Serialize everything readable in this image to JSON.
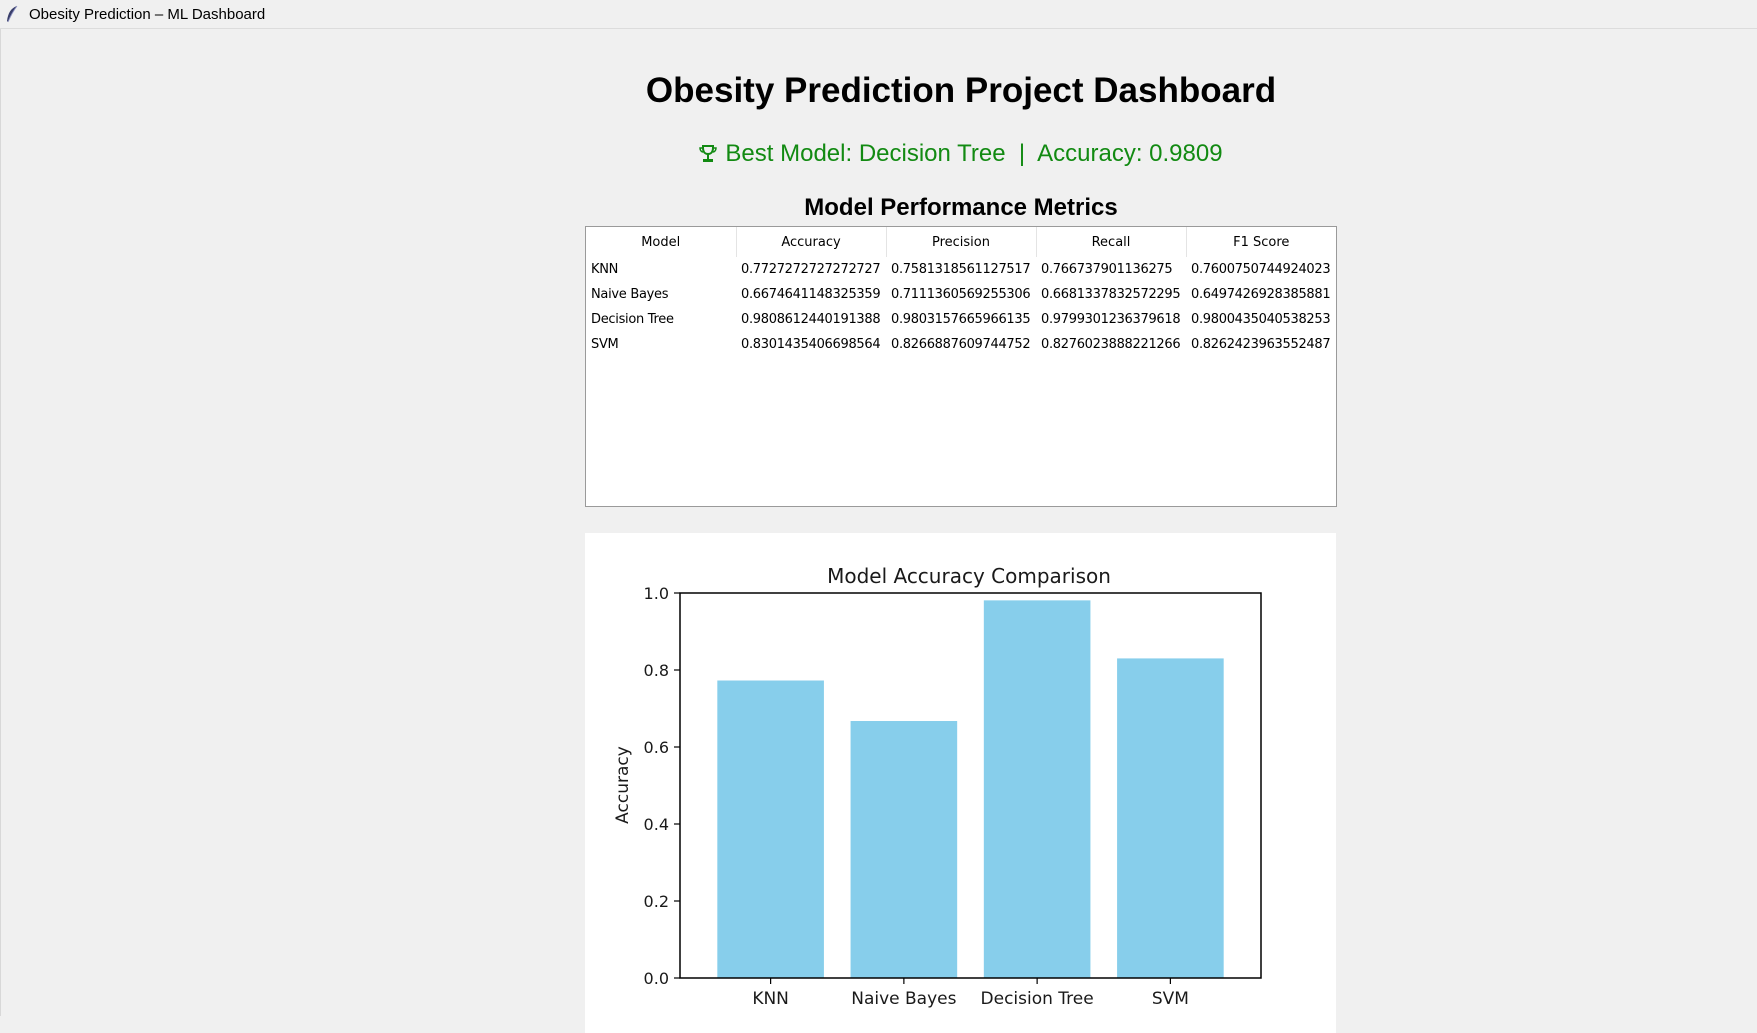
{
  "window": {
    "title": "Obesity Prediction – ML Dashboard",
    "icon": "feather-icon"
  },
  "heading": "Obesity Prediction Project Dashboard",
  "best_model": {
    "icon": "trophy-icon",
    "text": "Best Model: Decision Tree  |  Accuracy: 0.9809",
    "color": "#128a12"
  },
  "metrics": {
    "heading": "Model Performance Metrics",
    "columns": [
      "Model",
      "Accuracy",
      "Precision",
      "Recall",
      "F1 Score"
    ],
    "rows": [
      [
        "KNN",
        "0.7727272727272727",
        "0.7581318561127517",
        "0.766737901136275",
        "0.7600750744924023"
      ],
      [
        "Naive Bayes",
        "0.6674641148325359",
        "0.7111360569255306",
        "0.6681337832572295",
        "0.6497426928385881"
      ],
      [
        "Decision Tree",
        "0.9808612440191388",
        "0.9803157665966135",
        "0.9799301236379618",
        "0.9800435040538253"
      ],
      [
        "SVM",
        "0.8301435406698564",
        "0.8266887609744752",
        "0.8276023888221266",
        "0.8262423963552487"
      ]
    ]
  },
  "chart_data": {
    "type": "bar",
    "title": "Model Accuracy Comparison",
    "xlabel": "",
    "ylabel": "Accuracy",
    "categories": [
      "KNN",
      "Naive Bayes",
      "Decision Tree",
      "SVM"
    ],
    "values": [
      0.7727,
      0.6675,
      0.9809,
      0.8301
    ],
    "ylim": [
      0,
      1.0
    ],
    "yticks": [
      "0.0",
      "0.2",
      "0.4",
      "0.6",
      "0.8",
      "1.0"
    ],
    "bar_color": "#87ceeb",
    "grid": false,
    "legend": "none"
  }
}
